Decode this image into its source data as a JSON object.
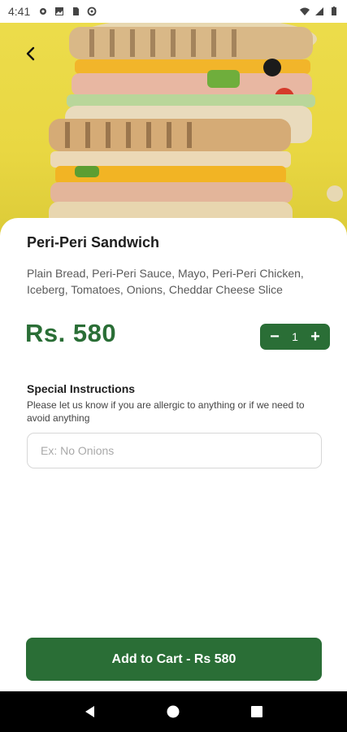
{
  "status_bar": {
    "time": "4:41",
    "left_icons": [
      "gear-icon",
      "photo-icon",
      "sim-card-icon",
      "sync-icon"
    ],
    "right_icons": [
      "wifi-icon",
      "signal-icon",
      "battery-icon"
    ]
  },
  "header": {
    "back_icon": "chevron-left-icon"
  },
  "product": {
    "title": "Peri-Peri Sandwich",
    "description": "Plain Bread, Peri-Peri Sauce, Mayo, Peri-Peri Chicken, Iceberg, Tomatoes, Onions, Cheddar Cheese Slice",
    "price": "Rs. 580",
    "quantity": "1",
    "decrement_label": "−",
    "increment_label": "+"
  },
  "special_instructions": {
    "title": "Special Instructions",
    "help": "Please let us know if you are allergic to anything or if we need to avoid anything",
    "placeholder": "Ex: No Onions",
    "value": ""
  },
  "cart": {
    "button_label": "Add to Cart - Rs 580"
  },
  "colors": {
    "accent_green": "#2a6e36",
    "hero_background": "#ecdc4b"
  }
}
